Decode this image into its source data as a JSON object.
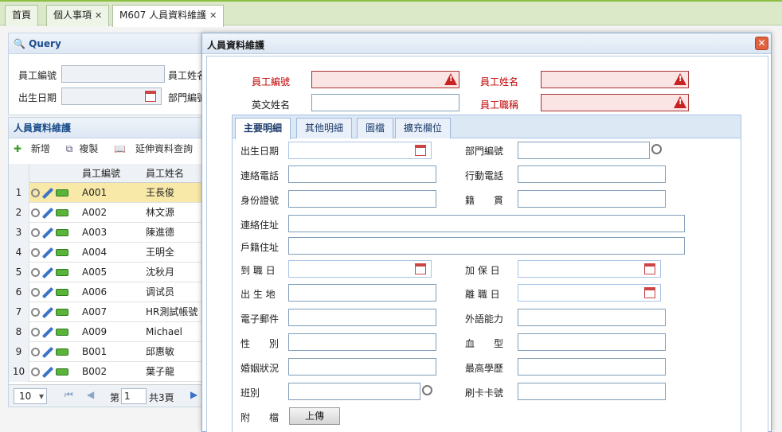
{
  "tabs": [
    {
      "label": "首頁",
      "closable": false
    },
    {
      "label": "個人事項",
      "closable": true
    },
    {
      "label": "M607 人員資料維護",
      "closable": true
    }
  ],
  "query": {
    "title": "Query",
    "emp_no_label": "員工編號",
    "emp_name_label": "員工姓名",
    "birth_label": "出生日期",
    "dept_label": "部門編號"
  },
  "list": {
    "title": "人員資料維護",
    "toolbar": {
      "add": "新增",
      "copy": "複製",
      "ext": "延伸資料查詢"
    },
    "columns": {
      "id": "員工編號",
      "name": "員工姓名"
    },
    "rows": [
      {
        "n": "1",
        "id": "A001",
        "name": "王長俊"
      },
      {
        "n": "2",
        "id": "A002",
        "name": "林文源"
      },
      {
        "n": "3",
        "id": "A003",
        "name": "陳進德"
      },
      {
        "n": "4",
        "id": "A004",
        "name": "王明全"
      },
      {
        "n": "5",
        "id": "A005",
        "name": "沈秋月"
      },
      {
        "n": "6",
        "id": "A006",
        "name": "调试员"
      },
      {
        "n": "7",
        "id": "A007",
        "name": "HR測試帳號"
      },
      {
        "n": "8",
        "id": "A009",
        "name": "Michael"
      },
      {
        "n": "9",
        "id": "B001",
        "name": "邱惠敏"
      },
      {
        "n": "10",
        "id": "B002",
        "name": "葉子龍"
      }
    ],
    "pager": {
      "size": "10",
      "page_prefix": "第",
      "page": "1",
      "total": "共3頁"
    }
  },
  "dialog": {
    "title": "人員資料維護",
    "emp_no": "員工編號",
    "emp_name": "員工姓名",
    "eng_name": "英文姓名",
    "emp_title": "員工職稱",
    "inner_tabs": [
      "主要明細",
      "其他明細",
      "圖檔",
      "擴充欄位"
    ],
    "fields": {
      "birth": "出生日期",
      "dept": "部門編號",
      "phone": "連絡電話",
      "mobile": "行動電話",
      "idno": "身份證號",
      "native": "籍　　貫",
      "addr": "連絡住址",
      "reg_addr": "戶籍住址",
      "onboard": "到 職 日",
      "insure": "加 保 日",
      "birthplace": "出 生 地",
      "leave": "離 職 日",
      "email": "電子郵件",
      "lang": "外語能力",
      "gender": "性　　別",
      "blood": "血　　型",
      "marital": "婚姻狀況",
      "edu": "最高學歷",
      "shift": "班別",
      "card": "刷卡卡號",
      "attach": "附　　檔"
    },
    "upload": "上傳"
  },
  "colors": {
    "accent": "#8dbf43",
    "required": "#c00000",
    "header_blue": "#1a4d8a"
  }
}
